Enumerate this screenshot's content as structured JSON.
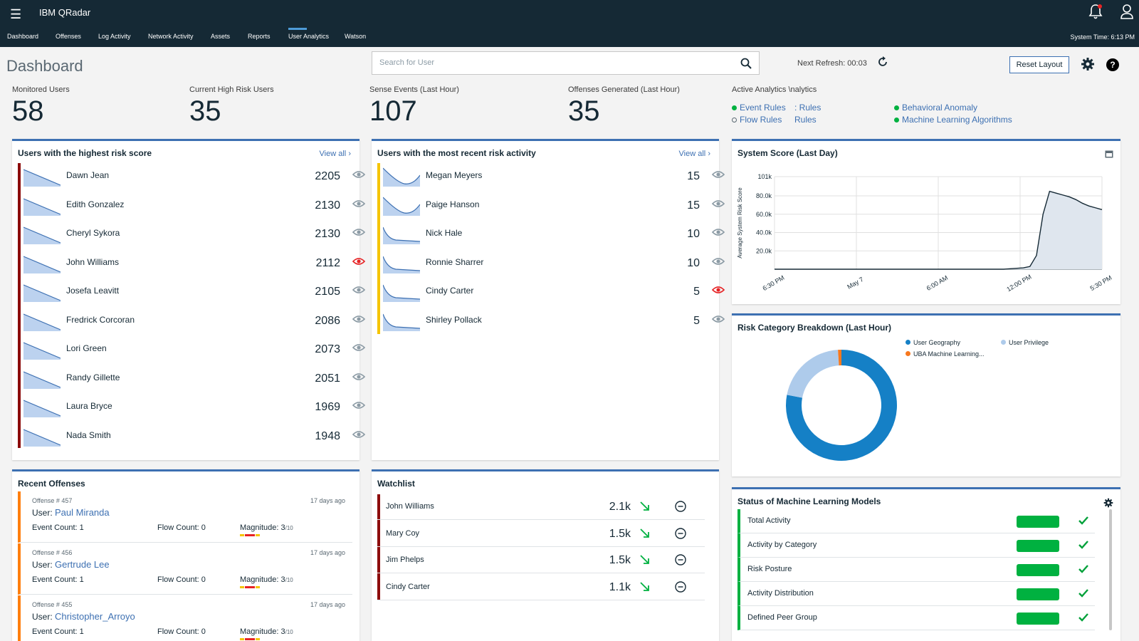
{
  "header": {
    "app_title": "IBM QRadar",
    "system_time": "System Time: 6:13 PM",
    "tabs": [
      "Dashboard",
      "Offenses",
      "Log Activity",
      "Network Activity",
      "Assets",
      "Reports",
      "User Analytics",
      "Watson"
    ],
    "active_tab": "User Analytics"
  },
  "toolbar": {
    "page_title": "Dashboard",
    "search_placeholder": "Search for User",
    "next_refresh": "Next Refresh:  00:03",
    "reset_label": "Reset Layout",
    "help_label": "?"
  },
  "stats": [
    {
      "label": "Monitored Users",
      "value": "58"
    },
    {
      "label": "Current High Risk Users",
      "value": "35"
    },
    {
      "label": "Sense Events (Last Hour)",
      "value": "107"
    },
    {
      "label": "Offenses Generated (Last Hour)",
      "value": "35"
    }
  ],
  "analytics": {
    "heading": "Active Analytics",
    "heading_overlap": "\\nalytics",
    "items": [
      {
        "label": "Event Rules",
        "active": true
      },
      {
        "label": "Flow Rules",
        "active": false
      },
      {
        "label": ": Rules",
        "active": null
      },
      {
        "label": "Rules",
        "active": null
      },
      {
        "label": "Behavioral Anomaly",
        "active": true
      },
      {
        "label": "Machine Learning Algorithms",
        "active": true
      }
    ]
  },
  "highest_risk": {
    "title": "Users with the highest risk score",
    "view_all": "View all",
    "rows": [
      {
        "name": "Dawn Jean",
        "score": "2205",
        "watched": false
      },
      {
        "name": "Edith Gonzalez",
        "score": "2130",
        "watched": false
      },
      {
        "name": "Cheryl Sykora",
        "score": "2130",
        "watched": false
      },
      {
        "name": "John Williams",
        "score": "2112",
        "watched": true
      },
      {
        "name": "Josefa Leavitt",
        "score": "2105",
        "watched": false
      },
      {
        "name": "Fredrick Corcoran",
        "score": "2086",
        "watched": false
      },
      {
        "name": "Lori Green",
        "score": "2073",
        "watched": false
      },
      {
        "name": "Randy Gillette",
        "score": "2051",
        "watched": false
      },
      {
        "name": "Laura Bryce",
        "score": "1969",
        "watched": false
      },
      {
        "name": "Nada Smith",
        "score": "1948",
        "watched": false
      }
    ]
  },
  "recent_risk": {
    "title": "Users with the most recent risk activity",
    "view_all": "View all",
    "rows": [
      {
        "name": "Megan Meyers",
        "score": "15",
        "watched": false
      },
      {
        "name": "Paige Hanson",
        "score": "15",
        "watched": false
      },
      {
        "name": "Nick Hale",
        "score": "10",
        "watched": false
      },
      {
        "name": "Ronnie Sharrer",
        "score": "10",
        "watched": false
      },
      {
        "name": "Cindy Carter",
        "score": "5",
        "watched": true
      },
      {
        "name": "Shirley Pollack",
        "score": "5",
        "watched": false
      }
    ]
  },
  "system_score": {
    "title": "System Score (Last Day)",
    "chart_data": {
      "type": "area",
      "title": "System Score (Last Day)",
      "ylabel": "Average System Risk Score",
      "xlabel": "",
      "x_ticks": [
        "6:30 PM",
        "May 7",
        "6:00 AM",
        "12:00 PM",
        "5:30 PM"
      ],
      "y_ticks": [
        "20.0k",
        "40.0k",
        "60.0k",
        "80.0k",
        "101k"
      ],
      "ylim": [
        0,
        101000
      ],
      "x": [
        0,
        0.7,
        0.72,
        0.74,
        0.76,
        0.78,
        0.8,
        0.82,
        0.84,
        0.86,
        0.88,
        0.9,
        0.92,
        0.94,
        0.96,
        0.98,
        1.0
      ],
      "values": [
        0,
        0,
        500,
        1000,
        1500,
        3000,
        15000,
        60000,
        85000,
        83000,
        81000,
        79000,
        76000,
        72000,
        69000,
        67000,
        65000
      ]
    }
  },
  "risk_category": {
    "title": "Risk Category Breakdown (Last Hour)",
    "chart_data": {
      "type": "pie",
      "title": "Risk Category Breakdown (Last Hour)",
      "categories": [
        "User Geography",
        "User Privilege",
        "UBA Machine Learning..."
      ],
      "values": [
        78,
        21,
        1
      ],
      "colors": [
        "#1580c6",
        "#aecbeb",
        "#f7781e"
      ]
    }
  },
  "recent_offenses": {
    "title": "Recent Offenses",
    "rows": [
      {
        "num": "Offense # 457",
        "age": "17 days ago",
        "user_prefix": "User:",
        "user": "Paul Miranda",
        "event": "Event Count: 1",
        "flow": "Flow Count: 0",
        "mag": "Magnitude: 3",
        "mag_max": "/10"
      },
      {
        "num": "Offense # 456",
        "age": "17 days ago",
        "user_prefix": "User:",
        "user": "Gertrude Lee",
        "event": "Event Count: 1",
        "flow": "Flow Count: 0",
        "mag": "Magnitude: 3",
        "mag_max": "/10"
      },
      {
        "num": "Offense # 455",
        "age": "17 days ago",
        "user_prefix": "User:",
        "user": "Christopher_Arroyo",
        "event": "Event Count: 1",
        "flow": "Flow Count: 0",
        "mag": "Magnitude: 3",
        "mag_max": "/10"
      }
    ]
  },
  "watchlist": {
    "title": "Watchlist",
    "rows": [
      {
        "name": "John Williams",
        "value": "2.1k"
      },
      {
        "name": "Mary Coy",
        "value": "1.5k"
      },
      {
        "name": "Jim Phelps",
        "value": "1.5k"
      },
      {
        "name": "Cindy Carter",
        "value": "1.1k"
      }
    ]
  },
  "ml_models": {
    "title": "Status of Machine Learning Models",
    "rows": [
      {
        "name": "Total Activity"
      },
      {
        "name": "Activity by Category"
      },
      {
        "name": "Risk Posture"
      },
      {
        "name": "Activity Distribution"
      },
      {
        "name": "Defined Peer Group"
      }
    ]
  },
  "colors": {
    "header_bg": "#152935",
    "accent": "#3d70b2",
    "risk_red": "#8c0c0c",
    "risk_yellow": "#f5c400",
    "offense_orange": "#ff7f0e",
    "ok_green": "#00b140",
    "alert_red": "#e62325"
  },
  "icons": [
    "menu-icon",
    "bell-icon",
    "user-icon",
    "search-icon",
    "refresh-icon",
    "gear-icon",
    "help-icon",
    "eye-icon",
    "calendar-icon",
    "arrow-down-right-icon",
    "remove-icon",
    "checkmark-icon"
  ]
}
